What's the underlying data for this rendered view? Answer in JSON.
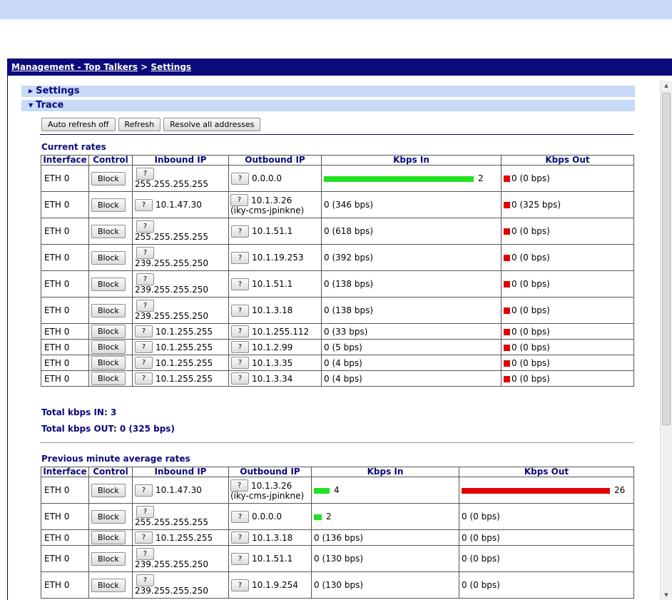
{
  "breadcrumb": {
    "part1": "Management - Top Talkers",
    "sep": " > ",
    "part2": "Settings"
  },
  "sections": {
    "settings": "Settings",
    "trace": "Trace"
  },
  "trace_buttons": {
    "auto_refresh": "Auto refresh off",
    "refresh": "Refresh",
    "resolve": "Resolve all addresses"
  },
  "labels": {
    "q": "?",
    "block": "Block"
  },
  "current": {
    "title": "Current rates",
    "headers": [
      "Interface",
      "Control",
      "Inbound IP",
      "Outbound IP",
      "Kbps In",
      "Kbps Out"
    ],
    "total_in": "Total kbps IN: 3",
    "total_out": "Total kbps OUT: 0 (325 bps)",
    "rows": [
      {
        "iface": "ETH 0",
        "in_ip": "255.255.255.255",
        "in_stack": true,
        "out_ip": "0.0.0.0",
        "out_host": "",
        "kin": "2",
        "kin_bar": 1.0,
        "kout": "0 (0 bps)",
        "kout_sq": true
      },
      {
        "iface": "ETH 0",
        "in_ip": "10.1.47.30",
        "in_stack": false,
        "out_ip": "10.1.3.26",
        "out_host": "(iky-cms-jpinkne)",
        "kin": "0 (346 bps)",
        "kin_bar": 0,
        "kout": "0 (325 bps)",
        "kout_sq": true
      },
      {
        "iface": "ETH 0",
        "in_ip": "255.255.255.255",
        "in_stack": true,
        "out_ip": "10.1.51.1",
        "out_host": "",
        "kin": "0 (618 bps)",
        "kin_bar": 0,
        "kout": "0 (0 bps)",
        "kout_sq": true
      },
      {
        "iface": "ETH 0",
        "in_ip": "239.255.255.250",
        "in_stack": true,
        "out_ip": "10.1.19.253",
        "out_host": "",
        "kin": "0 (392 bps)",
        "kin_bar": 0,
        "kout": "0 (0 bps)",
        "kout_sq": true
      },
      {
        "iface": "ETH 0",
        "in_ip": "239.255.255.250",
        "in_stack": true,
        "out_ip": "10.1.51.1",
        "out_host": "",
        "kin": "0 (138 bps)",
        "kin_bar": 0,
        "kout": "0 (0 bps)",
        "kout_sq": true
      },
      {
        "iface": "ETH 0",
        "in_ip": "239.255.255.250",
        "in_stack": true,
        "out_ip": "10.1.3.18",
        "out_host": "",
        "kin": "0 (138 bps)",
        "kin_bar": 0,
        "kout": "0 (0 bps)",
        "kout_sq": true
      },
      {
        "iface": "ETH 0",
        "in_ip": "10.1.255.255",
        "in_stack": false,
        "out_ip": "10.1.255.112",
        "out_host": "",
        "kin": "0 (33 bps)",
        "kin_bar": 0,
        "kout": "0 (0 bps)",
        "kout_sq": true
      },
      {
        "iface": "ETH 0",
        "in_ip": "10.1.255.255",
        "in_stack": false,
        "out_ip": "10.1.2.99",
        "out_host": "",
        "kin": "0 (5 bps)",
        "kin_bar": 0,
        "kout": "0 (0 bps)",
        "kout_sq": true
      },
      {
        "iface": "ETH 0",
        "in_ip": "10.1.255.255",
        "in_stack": false,
        "out_ip": "10.1.3.35",
        "out_host": "",
        "kin": "0 (4 bps)",
        "kin_bar": 0,
        "kout": "0 (0 bps)",
        "kout_sq": true
      },
      {
        "iface": "ETH 0",
        "in_ip": "10.1.255.255",
        "in_stack": false,
        "out_ip": "10.1.3.34",
        "out_host": "",
        "kin": "0 (4 bps)",
        "kin_bar": 0,
        "kout": "0 (0 bps)",
        "kout_sq": true
      }
    ]
  },
  "previous": {
    "title": "Previous minute average rates",
    "headers": [
      "Interface",
      "Control",
      "Inbound IP",
      "Outbound IP",
      "Kbps In",
      "Kbps Out"
    ],
    "rows": [
      {
        "iface": "ETH 0",
        "in_ip": "10.1.47.30",
        "in_stack": false,
        "out_ip": "10.1.3.26",
        "out_host": "(iky-cms-jpinkne)",
        "kin": "4",
        "kin_bar": 0.1538,
        "kout": "26",
        "kout_bar": 1.0
      },
      {
        "iface": "ETH 0",
        "in_ip": "255.255.255.255",
        "in_stack": true,
        "out_ip": "0.0.0.0",
        "out_host": "",
        "kin": "2",
        "kin_bar": 0.0769,
        "kout": "0 (0 bps)",
        "kout_bar": 0
      },
      {
        "iface": "ETH 0",
        "in_ip": "10.1.255.255",
        "in_stack": false,
        "out_ip": "10.1.3.18",
        "out_host": "",
        "kin": "0 (136 bps)",
        "kin_bar": 0,
        "kout": "0 (0 bps)",
        "kout_bar": 0
      },
      {
        "iface": "ETH 0",
        "in_ip": "239.255.255.250",
        "in_stack": true,
        "out_ip": "10.1.51.1",
        "out_host": "",
        "kin": "0 (130 bps)",
        "kin_bar": 0,
        "kout": "0 (0 bps)",
        "kout_bar": 0
      },
      {
        "iface": "ETH 0",
        "in_ip": "239.255.255.250",
        "in_stack": true,
        "out_ip": "10.1.9.254",
        "out_host": "",
        "kin": "0 (130 bps)",
        "kin_bar": 0,
        "kout": "0 (0 bps)",
        "kout_bar": 0
      }
    ]
  },
  "colors": {
    "in_bar": "#22e022",
    "out_bar": "#e00000",
    "accent": "#0a0a7a",
    "section_bg": "#c8daf8"
  }
}
